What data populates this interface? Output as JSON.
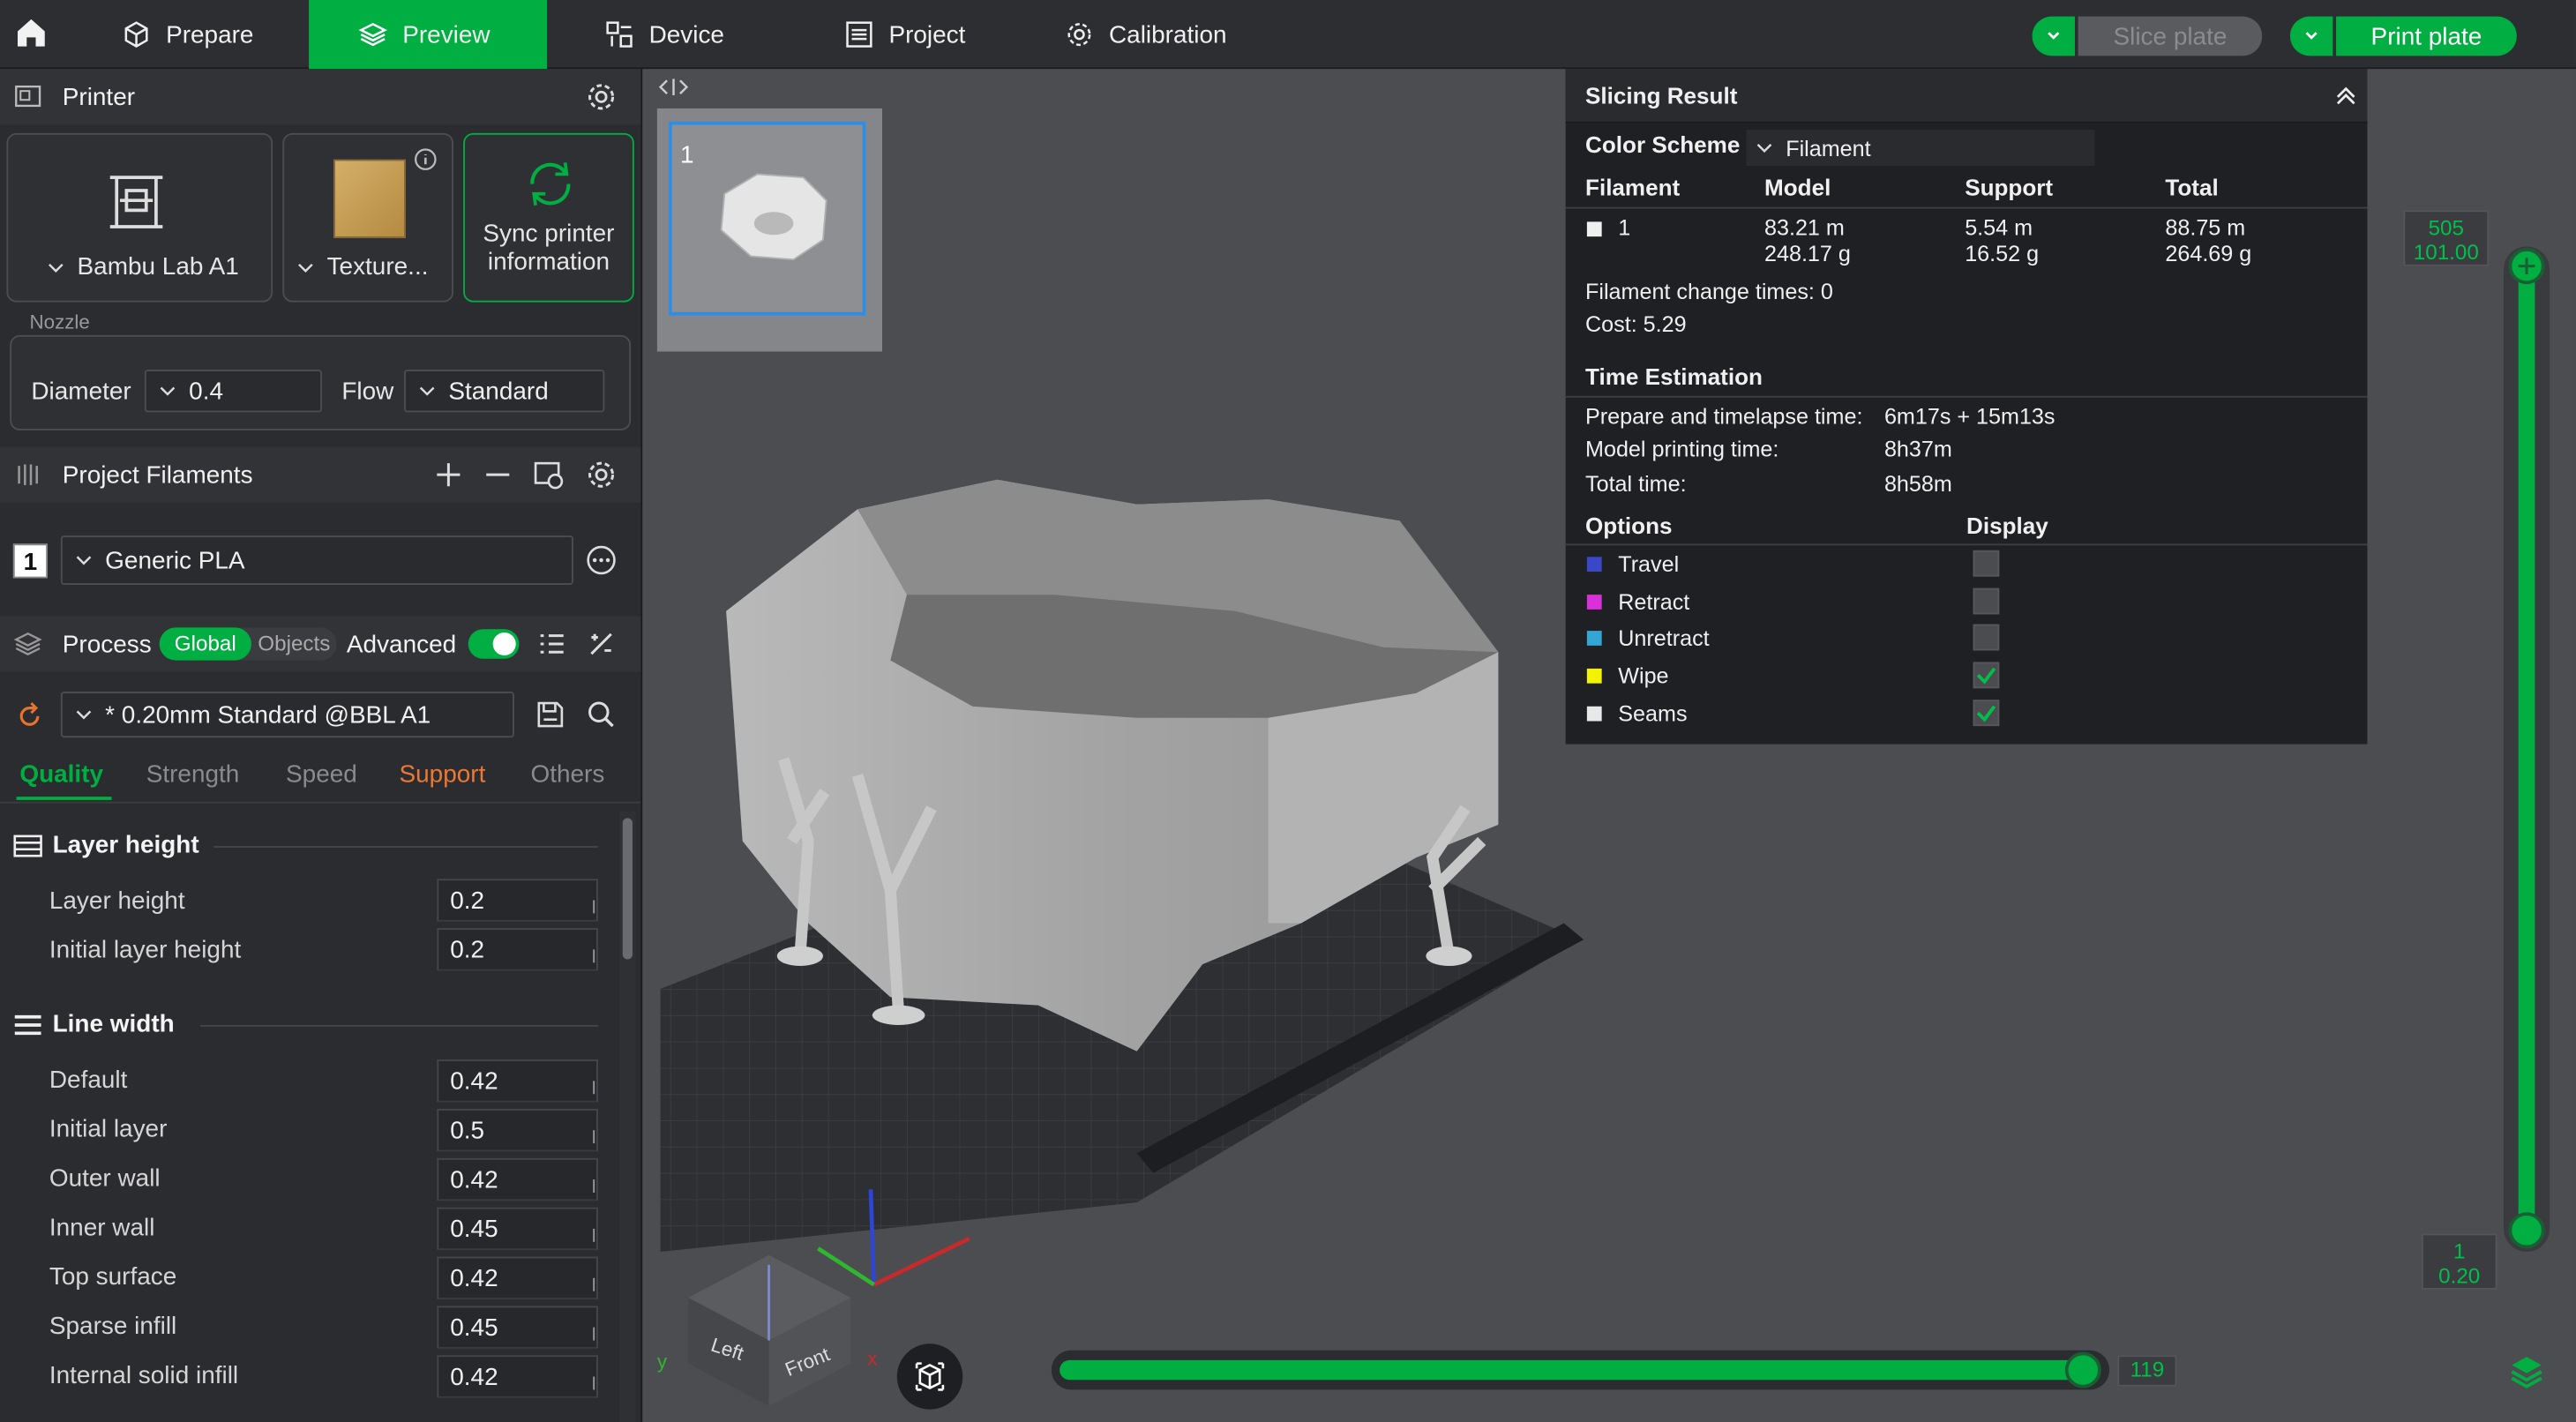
{
  "topbar": {
    "tabs": [
      {
        "label": "Prepare",
        "icon": "cube-icon"
      },
      {
        "label": "Preview",
        "icon": "layers-icon"
      },
      {
        "label": "Device",
        "icon": "device-icon"
      },
      {
        "label": "Project",
        "icon": "list-icon"
      },
      {
        "label": "Calibration",
        "icon": "gear-icon"
      }
    ],
    "slice_label": "Slice plate",
    "print_label": "Print plate"
  },
  "printer": {
    "title": "Printer",
    "printer_name": "Bambu Lab A1",
    "plate_name": "Texture...",
    "sync_label_1": "Sync printer",
    "sync_label_2": "information",
    "nozzle_label": "Nozzle",
    "diameter_label": "Diameter",
    "diameter_value": "0.4",
    "flow_label": "Flow",
    "flow_value": "Standard"
  },
  "filaments": {
    "title": "Project Filaments",
    "slot": "1",
    "name": "Generic PLA"
  },
  "process": {
    "title": "Process",
    "global_label": "Global",
    "objects_label": "Objects",
    "advanced_label": "Advanced",
    "preset": "* 0.20mm Standard @BBL A1",
    "tabs": [
      "Quality",
      "Strength",
      "Speed",
      "Support",
      "Others"
    ],
    "layer_height_group": "Layer height",
    "layer_params": [
      {
        "label": "Layer height",
        "value": "0.2"
      },
      {
        "label": "Initial layer height",
        "value": "0.2"
      }
    ],
    "line_width_group": "Line width",
    "line_params": [
      {
        "label": "Default",
        "value": "0.42"
      },
      {
        "label": "Initial layer",
        "value": "0.5"
      },
      {
        "label": "Outer wall",
        "value": "0.42"
      },
      {
        "label": "Inner wall",
        "value": "0.45"
      },
      {
        "label": "Top surface",
        "value": "0.42"
      },
      {
        "label": "Sparse infill",
        "value": "0.45"
      },
      {
        "label": "Internal solid infill",
        "value": "0.42"
      }
    ]
  },
  "viewport": {
    "plate_number": "1",
    "cube_left": "Left",
    "cube_front": "Front",
    "axis_y": "y",
    "axis_x": "x",
    "layer_top_num": "505",
    "layer_top_height": "101.00",
    "layer_bottom_num": "1",
    "layer_bottom_height": "0.20",
    "move_value": "119"
  },
  "result": {
    "title": "Slicing Result",
    "color_scheme_label": "Color Scheme",
    "color_scheme_value": "Filament",
    "col_filament": "Filament",
    "col_model": "Model",
    "col_support": "Support",
    "col_total": "Total",
    "row_id": "1",
    "model_len": "83.21 m",
    "model_wt": "248.17 g",
    "support_len": "5.54 m",
    "support_wt": "16.52 g",
    "total_len": "88.75 m",
    "total_wt": "264.69 g",
    "change_times": "Filament change times:  0",
    "cost": "Cost:  5.29",
    "time_title": "Time Estimation",
    "prep_label": "Prepare and timelapse time:",
    "prep_value": "6m17s + 15m13s",
    "model_time_label": "Model printing time:",
    "model_time_value": "8h37m",
    "total_time_label": "Total time:",
    "total_time_value": "8h58m",
    "options_label": "Options",
    "display_label": "Display",
    "options": [
      {
        "label": "Travel",
        "color": "#3a48c8",
        "checked": false
      },
      {
        "label": "Retract",
        "color": "#d930d9",
        "checked": false
      },
      {
        "label": "Unretract",
        "color": "#33a6d6",
        "checked": false
      },
      {
        "label": "Wipe",
        "color": "#f3f300",
        "checked": true
      },
      {
        "label": "Seams",
        "color": "#e8e8e8",
        "checked": true
      }
    ]
  },
  "colors": {
    "accent": "#00ae42",
    "panel": "#2b2c2f",
    "viewport": "#4c4d51"
  }
}
